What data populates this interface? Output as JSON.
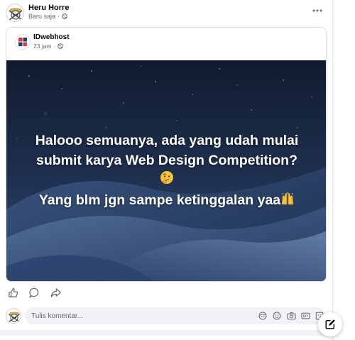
{
  "post": {
    "author": "Heru Horre",
    "time": "Baru saja",
    "separator": "·",
    "privacy_icon": "globe-icon",
    "more_icon": "more-options-icon"
  },
  "shared_post": {
    "page_name": "IDwebhost",
    "time": "23 jam",
    "separator": "·",
    "privacy_icon": "globe-icon",
    "headline_line1": "Halooo semuanya, ada yang udah mulai",
    "headline_line2": "submit karya Web Design Competition?",
    "headline_emoji1": "🤔",
    "headline_line4": "Yang blm jgn sampe ketinggalan yaa",
    "headline_emoji2": "🙌"
  },
  "actions": {
    "like_icon": "like-icon",
    "comment_icon": "comment-icon",
    "share_icon": "share-icon"
  },
  "comment": {
    "placeholder": "Tulis komentar...",
    "icons": [
      "avatar-sticker-icon",
      "emoji-icon",
      "camera-icon",
      "gif-icon",
      "sticker-icon"
    ]
  },
  "compose_icon": "compose-icon",
  "colors": {
    "text_primary": "#050505",
    "text_secondary": "#65676b",
    "icon": "#65676b",
    "background": "#f0f2f5",
    "photo_sky": "#1b2a45"
  }
}
